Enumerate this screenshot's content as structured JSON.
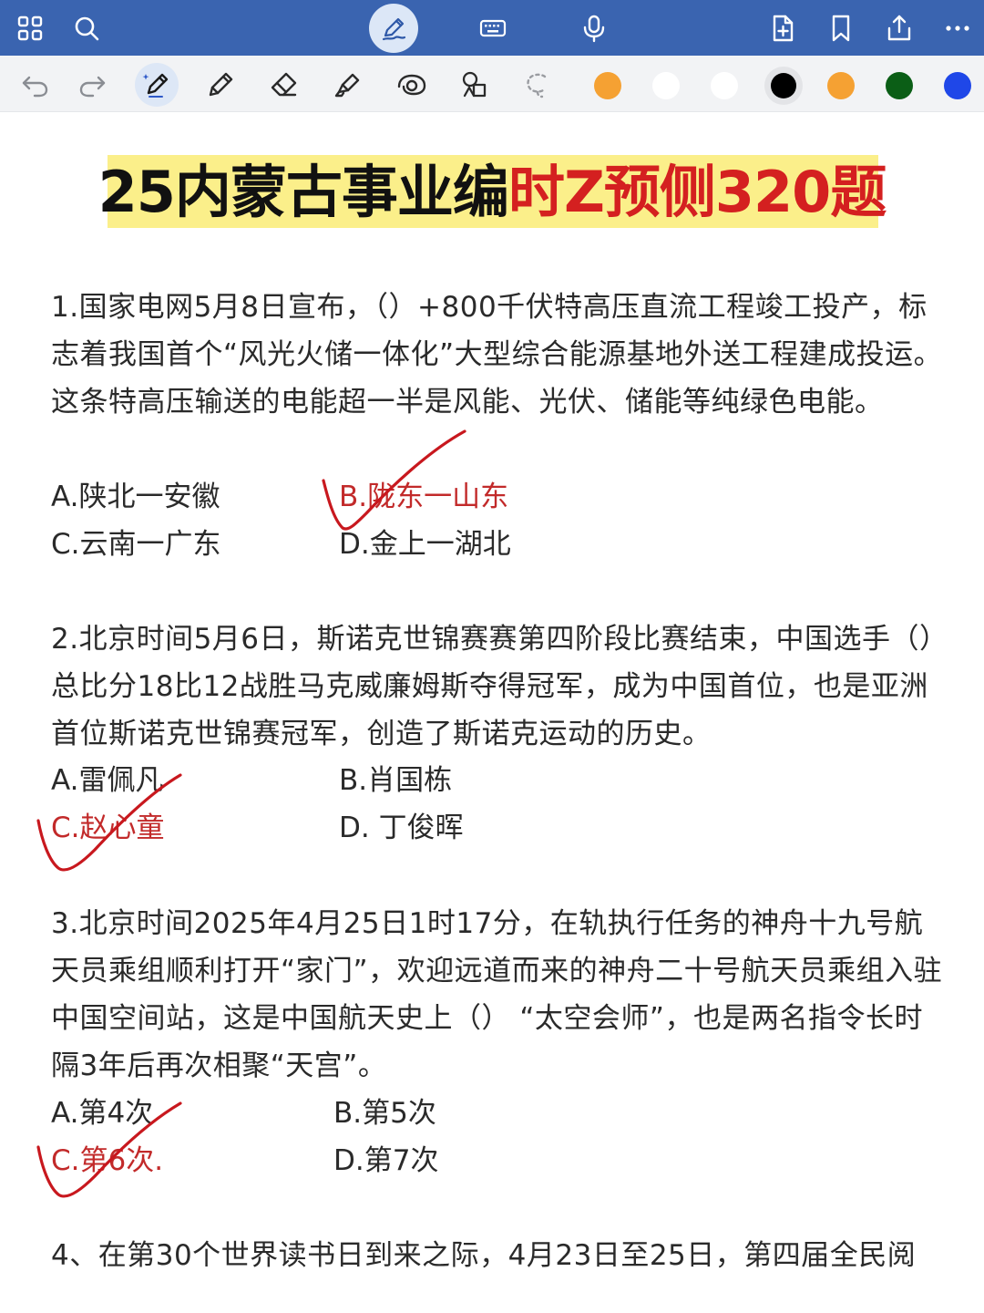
{
  "toolbar_colors": {
    "orange1": "#f5a133",
    "white1": "#ffffff",
    "white2": "#ffffff",
    "black_selected": "#000000",
    "orange2": "#f5a133",
    "green": "#0b5e16",
    "blue": "#1f47e8"
  },
  "icons": {
    "top": [
      "grid-icon",
      "search-icon",
      "pen-mode-icon",
      "keyboard-icon",
      "microphone-icon",
      "add-page-icon",
      "bookmark-icon",
      "share-icon",
      "more-icon"
    ],
    "tools": [
      "undo-icon",
      "redo-icon",
      "fountain-pen-icon",
      "pencil-icon",
      "eraser-icon",
      "highlighter-icon",
      "shape-icon",
      "sticker-icon",
      "lasso-icon"
    ]
  },
  "document": {
    "title_black": "25内蒙古事业编",
    "title_red": "时Z预侧320题",
    "questions": [
      {
        "text": "1.国家电网5月8日宣布，（）+800千伏特高压直流工程竣工投产，标志着我国首个“风光火储一体化”大型综合能源基地外送工程建成投运。这条特高压输送的电能超一半是风能、光伏、储能等纯绿色电能。",
        "options": [
          "A.陕北一安徽",
          "B.陇东一山东",
          "C.云南一广东",
          "D.金上一湖北"
        ],
        "answer_index": 1
      },
      {
        "text": "2.北京时间5月6日，斯诺克世锦赛赛第四阶段比赛结束，中国选手（）总比分18比12战胜马克威廉姆斯夺得冠军，成为中国首位，也是亚洲首位斯诺克世锦赛冠军，创造了斯诺克运动的历史。",
        "options": [
          "A.雷佩凡",
          "B.肖国栋",
          "C.赵心童",
          "D. 丁俊晖"
        ],
        "answer_index": 2
      },
      {
        "text": "3.北京时间2025年4月25日1时17分，在轨执行任务的神舟十九号航天员乘组顺利打开“家门”，欢迎远道而来的神舟二十号航天员乘组入驻中国空间站，这是中国航天史上（） “太空会师”，也是两名指令长时隔3年后再次相聚“天宫”。",
        "options": [
          "A.第4次",
          "B.第5次",
          "C.第6次.",
          "D.第7次"
        ],
        "answer_index": 2
      },
      {
        "text": "4、在第30个世界读书日到来之际，4月23日至25日，第四届全民阅"
      }
    ]
  }
}
